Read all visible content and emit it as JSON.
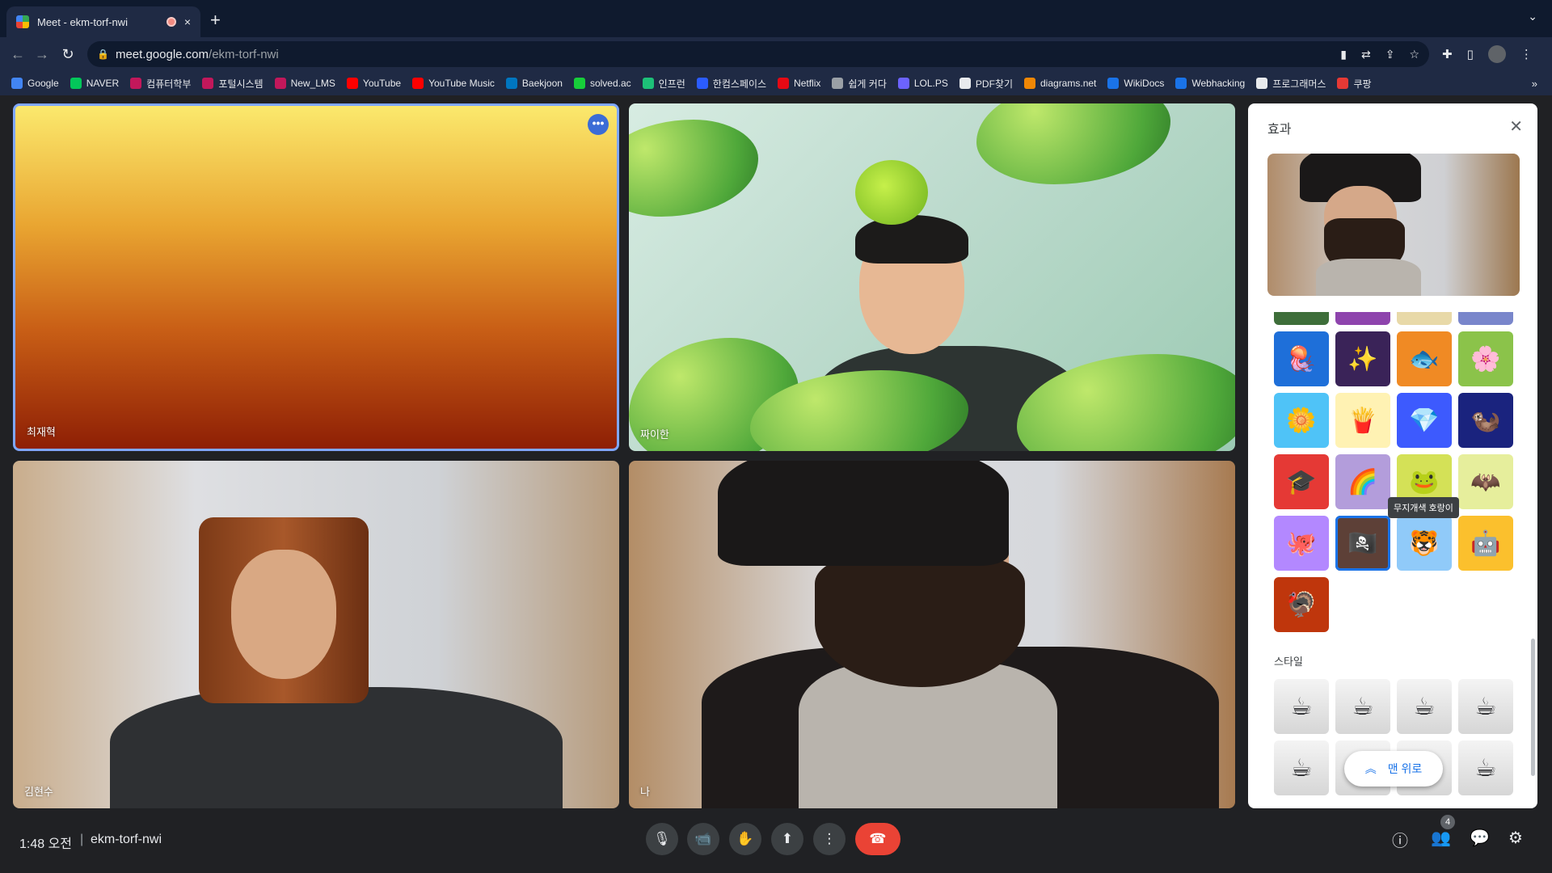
{
  "browser": {
    "tab_title": "Meet - ekm-torf-nwi",
    "tab_close": "×",
    "new_tab": "+",
    "tab_search": "⌄",
    "url_host": "meet.google.com",
    "url_path": "/ekm-torf-nwi",
    "nav": {
      "back": "←",
      "forward": "→",
      "reload": "↻"
    },
    "bookmarks": [
      {
        "label": "Google",
        "color": "#4285f4"
      },
      {
        "label": "NAVER",
        "color": "#03c75a"
      },
      {
        "label": "컴퓨터학부",
        "color": "#c2185b"
      },
      {
        "label": "포털시스템",
        "color": "#c2185b"
      },
      {
        "label": "New_LMS",
        "color": "#c2185b"
      },
      {
        "label": "YouTube",
        "color": "#ff0000"
      },
      {
        "label": "YouTube Music",
        "color": "#ff0000"
      },
      {
        "label": "Baekjoon",
        "color": "#0076c0"
      },
      {
        "label": "solved.ac",
        "color": "#17ce3a"
      },
      {
        "label": "인프런",
        "color": "#1dc078"
      },
      {
        "label": "한컴스페이스",
        "color": "#2b5cff"
      },
      {
        "label": "Netflix",
        "color": "#e50914"
      },
      {
        "label": "쉽게 커다",
        "color": "#9aa0a6"
      },
      {
        "label": "LOL.PS",
        "color": "#6c63ff"
      },
      {
        "label": "PDF찾기",
        "color": "#e8eaed"
      },
      {
        "label": "diagrams.net",
        "color": "#f08705"
      },
      {
        "label": "WikiDocs",
        "color": "#1a73e8"
      },
      {
        "label": "Webhacking",
        "color": "#1a73e8"
      },
      {
        "label": "프로그래머스",
        "color": "#e8eaed"
      },
      {
        "label": "쿠팡",
        "color": "#e53935"
      }
    ],
    "bookmarks_more": "»"
  },
  "participants": [
    {
      "name": "최재혁"
    },
    {
      "name": "짜이한"
    },
    {
      "name": "김현수"
    },
    {
      "name": "나"
    }
  ],
  "tile_menu": "•••",
  "effects_panel": {
    "title": "효과",
    "close": "✕",
    "effects_rows": [
      [
        "🪼",
        "✨",
        "🐟",
        "🌸"
      ],
      [
        "🌼",
        "🍟",
        "💎",
        "🦦"
      ],
      [
        "🎓",
        "🌈",
        "🐸",
        "🦇"
      ],
      [
        "🐙",
        "🏴‍☠️",
        "🐯",
        "🤖"
      ],
      [
        "🦃"
      ]
    ],
    "effects_colors": [
      [
        "#1e6fd9",
        "#3a2358",
        "#f08a24",
        "#8bc34a"
      ],
      [
        "#4fc3f7",
        "#fff2b3",
        "#3d5afe",
        "#1a237e"
      ],
      [
        "#e53935",
        "#b39ddb",
        "#d4e157",
        "#e6ee9c"
      ],
      [
        "#b388ff",
        "#5d4037",
        "#90caf9",
        "#fbc02d"
      ],
      [
        "#bf360c"
      ]
    ],
    "tooltip": "무지개색 호랑이",
    "style_label": "스타일",
    "style_rows": [
      [
        "☕",
        "☕",
        "☕",
        "☕"
      ],
      [
        "☕",
        "☕",
        "☕",
        "☕"
      ]
    ],
    "back_to_top": "맨 위로",
    "back_to_top_icon": "︽"
  },
  "bottom_bar": {
    "time": "1:48 오전",
    "separator": "|",
    "meeting_code": "ekm-torf-nwi",
    "controls": {
      "mic": "🎙",
      "camera": "📹",
      "raise_hand": "✋",
      "present": "⬆",
      "more": "⋮",
      "end_call": "☎"
    },
    "info_icon": "ⓘ",
    "people_icon": "👥",
    "people_count": "4",
    "chat_icon": "💬",
    "activities_icon": "⚙"
  }
}
